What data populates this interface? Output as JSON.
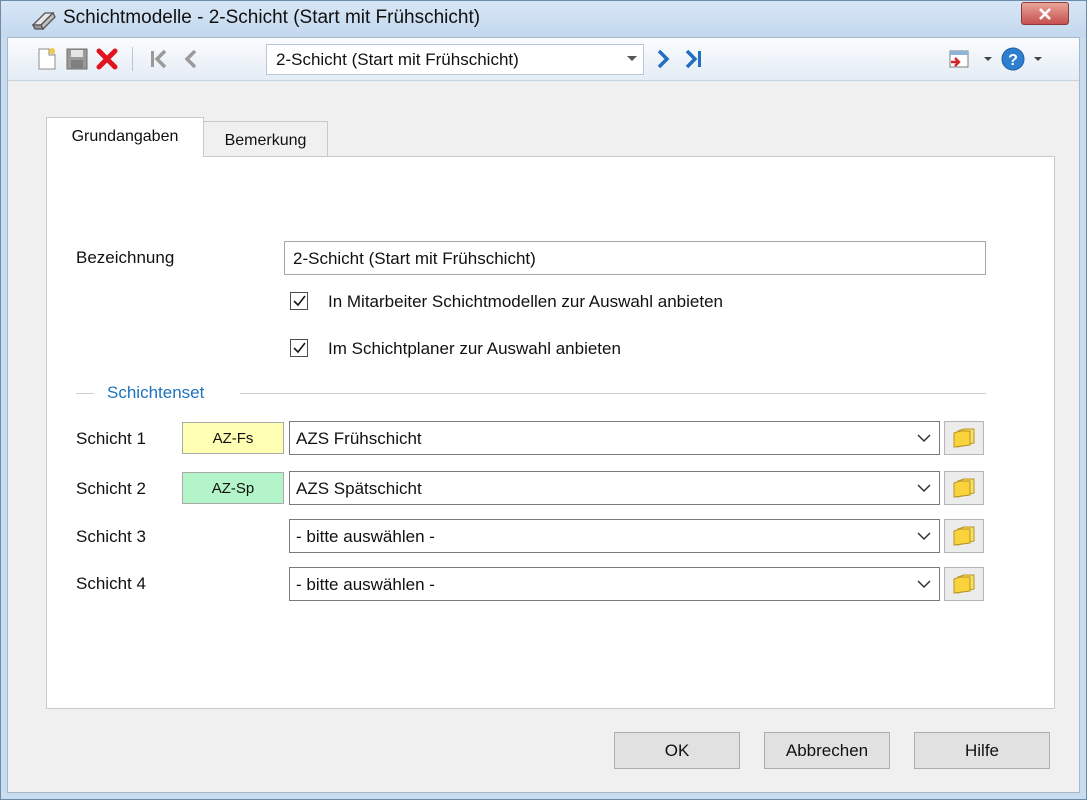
{
  "window": {
    "title": "Schichtmodelle - 2-Schicht (Start mit Frühschicht)"
  },
  "toolbar": {
    "icons": [
      "new-document-icon",
      "save-icon",
      "delete-icon",
      "first-record-icon",
      "previous-record-icon",
      "next-record-icon",
      "last-record-icon",
      "export-icon",
      "help-icon"
    ],
    "record_select_value": "2-Schicht (Start mit Frühschicht)"
  },
  "tabs": [
    {
      "label": "Grundangaben",
      "active": true
    },
    {
      "label": "Bemerkung",
      "active": false
    }
  ],
  "form": {
    "bezeichnung_label": "Bezeichnung",
    "bezeichnung_value": "2-Schicht (Start mit Frühschicht)",
    "checkbox1_label": "In Mitarbeiter Schichtmodellen zur Auswahl anbieten",
    "checkbox1_checked": true,
    "checkbox2_label": "Im Schichtplaner zur Auswahl anbieten",
    "checkbox2_checked": true,
    "group_label": "Schichtenset",
    "shifts": [
      {
        "label": "Schicht 1",
        "badge": "AZ-Fs",
        "badge_color": "#ffffb3",
        "value": "AZS Frühschicht"
      },
      {
        "label": "Schicht 2",
        "badge": "AZ-Sp",
        "badge_color": "#b3f5c8",
        "value": "AZS Spätschicht"
      },
      {
        "label": "Schicht 3",
        "badge": "",
        "badge_color": "",
        "value": "- bitte auswählen -"
      },
      {
        "label": "Schicht 4",
        "badge": "",
        "badge_color": "",
        "value": "- bitte auswählen -"
      }
    ]
  },
  "buttons": {
    "ok": "OK",
    "cancel": "Abbrechen",
    "help": "Hilfe"
  },
  "colors": {
    "group_label": "#1e73be",
    "close_button": "#c75050"
  }
}
